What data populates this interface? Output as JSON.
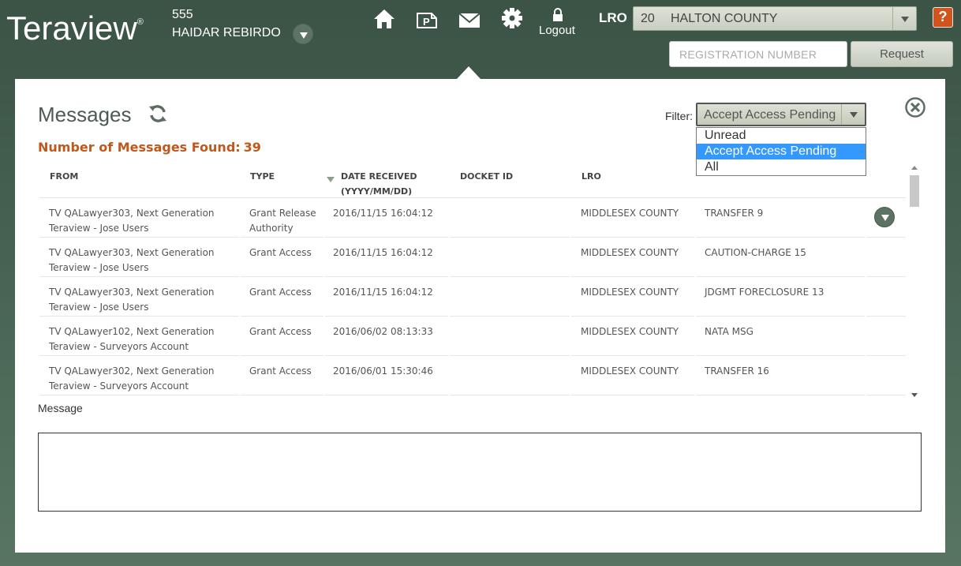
{
  "header": {
    "logo_text": "Teraview",
    "logo_mark": "®",
    "user_number": "555",
    "user_name": "HAIDAR REBIRDO",
    "nav": {
      "home_icon": "home-icon",
      "parcel_icon": "parcel-icon",
      "mail_icon": "mail-icon",
      "settings_icon": "gear-icon",
      "lock_icon": "lock-icon",
      "logout_label": "Logout"
    },
    "lro_label": "LRO",
    "lro_code": "20",
    "lro_name": "HALTON COUNTY",
    "help_label": "?",
    "registration_placeholder": "REGISTRATION NUMBER",
    "request_label": "Request"
  },
  "panel": {
    "title": "Messages",
    "found_label": "Number of Messages Found:",
    "found_count": "39",
    "filter_label": "Filter:",
    "filter_value": "Accept Access Pending",
    "filter_options": [
      "Unread",
      "Accept Access Pending",
      "All"
    ],
    "message_label": "Message",
    "message_value": ""
  },
  "table": {
    "columns": {
      "from": "FROM",
      "type": "TYPE",
      "date_line1": "DATE RECEIVED",
      "date_line2": "(YYYY/MM/DD)",
      "docket": "DOCKET ID",
      "lro": "LRO",
      "instrument": ""
    },
    "rows": [
      {
        "from1": "TV QALawyer303, Next Generation",
        "from2": "Teraview - Jose Users",
        "type1": "Grant Release",
        "type2": "Authority",
        "date": "2016/11/15 16:04:12",
        "docket": "",
        "lro": "MIDDLESEX COUNTY",
        "instrument": "TRANSFER 9"
      },
      {
        "from1": "TV QALawyer303, Next Generation",
        "from2": "Teraview - Jose Users",
        "type1": "Grant Access",
        "type2": "",
        "date": "2016/11/15 16:04:12",
        "docket": "",
        "lro": "MIDDLESEX COUNTY",
        "instrument": "CAUTION-CHARGE 15"
      },
      {
        "from1": "TV QALawyer303, Next Generation",
        "from2": "Teraview - Jose Users",
        "type1": "Grant Access",
        "type2": "",
        "date": "2016/11/15 16:04:12",
        "docket": "",
        "lro": "MIDDLESEX COUNTY",
        "instrument": "JDGMT FORECLOSURE 13"
      },
      {
        "from1": "TV QALawyer102, Next Generation",
        "from2": "Teraview - Surveyors Account",
        "type1": "Grant Access",
        "type2": "",
        "date": "2016/06/02 08:13:33",
        "docket": "",
        "lro": "MIDDLESEX COUNTY",
        "instrument": "NATA MSG"
      },
      {
        "from1": "TV QALawyer302, Next Generation",
        "from2": "Teraview - Surveyors Account",
        "type1": "Grant Access",
        "type2": "",
        "date": "2016/06/01 15:30:46",
        "docket": "",
        "lro": "MIDDLESEX COUNTY",
        "instrument": "TRANSFER 16"
      }
    ]
  },
  "colors": {
    "header_bg": "#3b5446",
    "accent_orange": "#c0581b",
    "selected_blue": "#3399ff"
  }
}
